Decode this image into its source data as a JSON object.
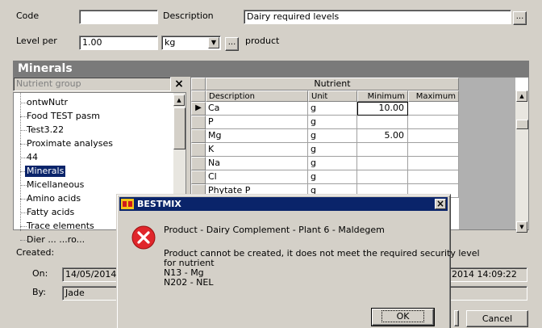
{
  "header": {
    "code_label": "Code",
    "code_value": "",
    "description_label": "Description",
    "description_value": "Dairy required levels",
    "level_per_label": "Level per",
    "level_per_value": "1.00",
    "unit_value": "kg",
    "product_label": "product",
    "ellipsis": "..."
  },
  "section": {
    "title": "Minerals"
  },
  "tree": {
    "search_placeholder": "Nutrient group",
    "items": [
      "ontwNutr",
      "Food TEST pasm",
      "Test3.22",
      "Proximate analyses",
      "44",
      "Minerals",
      "Micellaneous",
      "Amino acids",
      "Fatty acids",
      "Trace elements",
      "Dier ... ...ro..."
    ],
    "selected_index": 5
  },
  "grid": {
    "group_header": "Nutrient",
    "columns": [
      "Description",
      "Unit",
      "Minimum",
      "Maximum"
    ],
    "rows": [
      {
        "description": "Ca",
        "unit": "g",
        "minimum": "10.00",
        "maximum": ""
      },
      {
        "description": "P",
        "unit": "g",
        "minimum": "",
        "maximum": ""
      },
      {
        "description": "Mg",
        "unit": "g",
        "minimum": "5.00",
        "maximum": ""
      },
      {
        "description": "K",
        "unit": "g",
        "minimum": "",
        "maximum": ""
      },
      {
        "description": "Na",
        "unit": "g",
        "minimum": "",
        "maximum": ""
      },
      {
        "description": "Cl",
        "unit": "g",
        "minimum": "",
        "maximum": ""
      },
      {
        "description": "Phytate P",
        "unit": "g",
        "minimum": "",
        "maximum": ""
      }
    ],
    "current_row_marker": "▶"
  },
  "footer": {
    "created_label": "Created:",
    "on_label": "On:",
    "on_value": "14/05/2014",
    "by_label": "By:",
    "by_value": "Jade",
    "modified_on_value": "2014 14:09:22",
    "cancel_label": "Cancel"
  },
  "dialog": {
    "title": "BESTMIX",
    "line1": "Product  - Dairy Complement - Plant 6 - Maldegem",
    "line2": "Product cannot be created, it does not meet the required security level",
    "line3": "for nutrient",
    "line4": "N13 - Mg",
    "line5": "N202 - NEL",
    "ok_label": "OK",
    "close_glyph": "×"
  },
  "colors": {
    "titlebar": "#0a246a",
    "section_header": "#7a7a7a",
    "error_icon": "#e0262b"
  }
}
